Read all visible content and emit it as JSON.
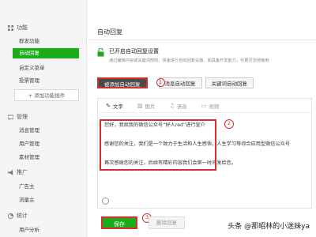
{
  "sidebar": {
    "sections": [
      {
        "label": "功能",
        "icon": "grid-icon",
        "items": [
          "群发功能",
          "自动回复",
          "自定义菜单",
          "投票管理"
        ]
      },
      {
        "label": "管理",
        "icon": "chat-icon",
        "items": [
          "消息管理",
          "用户管理",
          "素材管理"
        ]
      },
      {
        "label": "推广",
        "icon": "megaphone-icon",
        "items": [
          "广告主",
          "流量主"
        ]
      },
      {
        "label": "统计",
        "icon": "chart-icon",
        "items": [
          "用户分析"
        ]
      }
    ],
    "active_item": "自动回复",
    "add_plugin": "+ 添加功能插件"
  },
  "main": {
    "title": "自动回复",
    "status_title": "已开启自动回复设置",
    "status_desc": "通过编辑内容或关键词规则，快速进行自动回复设置。如具备开发能力，可更灵活地使用",
    "tabs": [
      "被添加自动回复",
      "消息自动回复",
      "关键词自动回复"
    ],
    "active_tab": "被添加自动回复"
  },
  "editor": {
    "tools": [
      {
        "label": "文字",
        "icon": "pen-icon"
      },
      {
        "label": "图片",
        "icon": "image-icon"
      },
      {
        "label": "语音",
        "icon": "mic-icon"
      },
      {
        "label": "视频",
        "icon": "video-icon"
      }
    ],
    "lines": [
      "您好，我就我的微信公众号“好人red”进行宣介",
      "感谢您的关注，我们是一个致力于生活和人生感悟，人生学习等综合应用型微信公众号",
      "再次感谢您的关注，后续有精彩内容我们会第一时间发给您。"
    ]
  },
  "buttons": {
    "save": "保存",
    "delete": "删除回复"
  },
  "annotations": [
    "1",
    "2",
    "3"
  ],
  "watermark": "头条 @那昭林的小迷妹ya",
  "colors": {
    "accent": "#1aad19",
    "highlight": "#d32f2f"
  }
}
